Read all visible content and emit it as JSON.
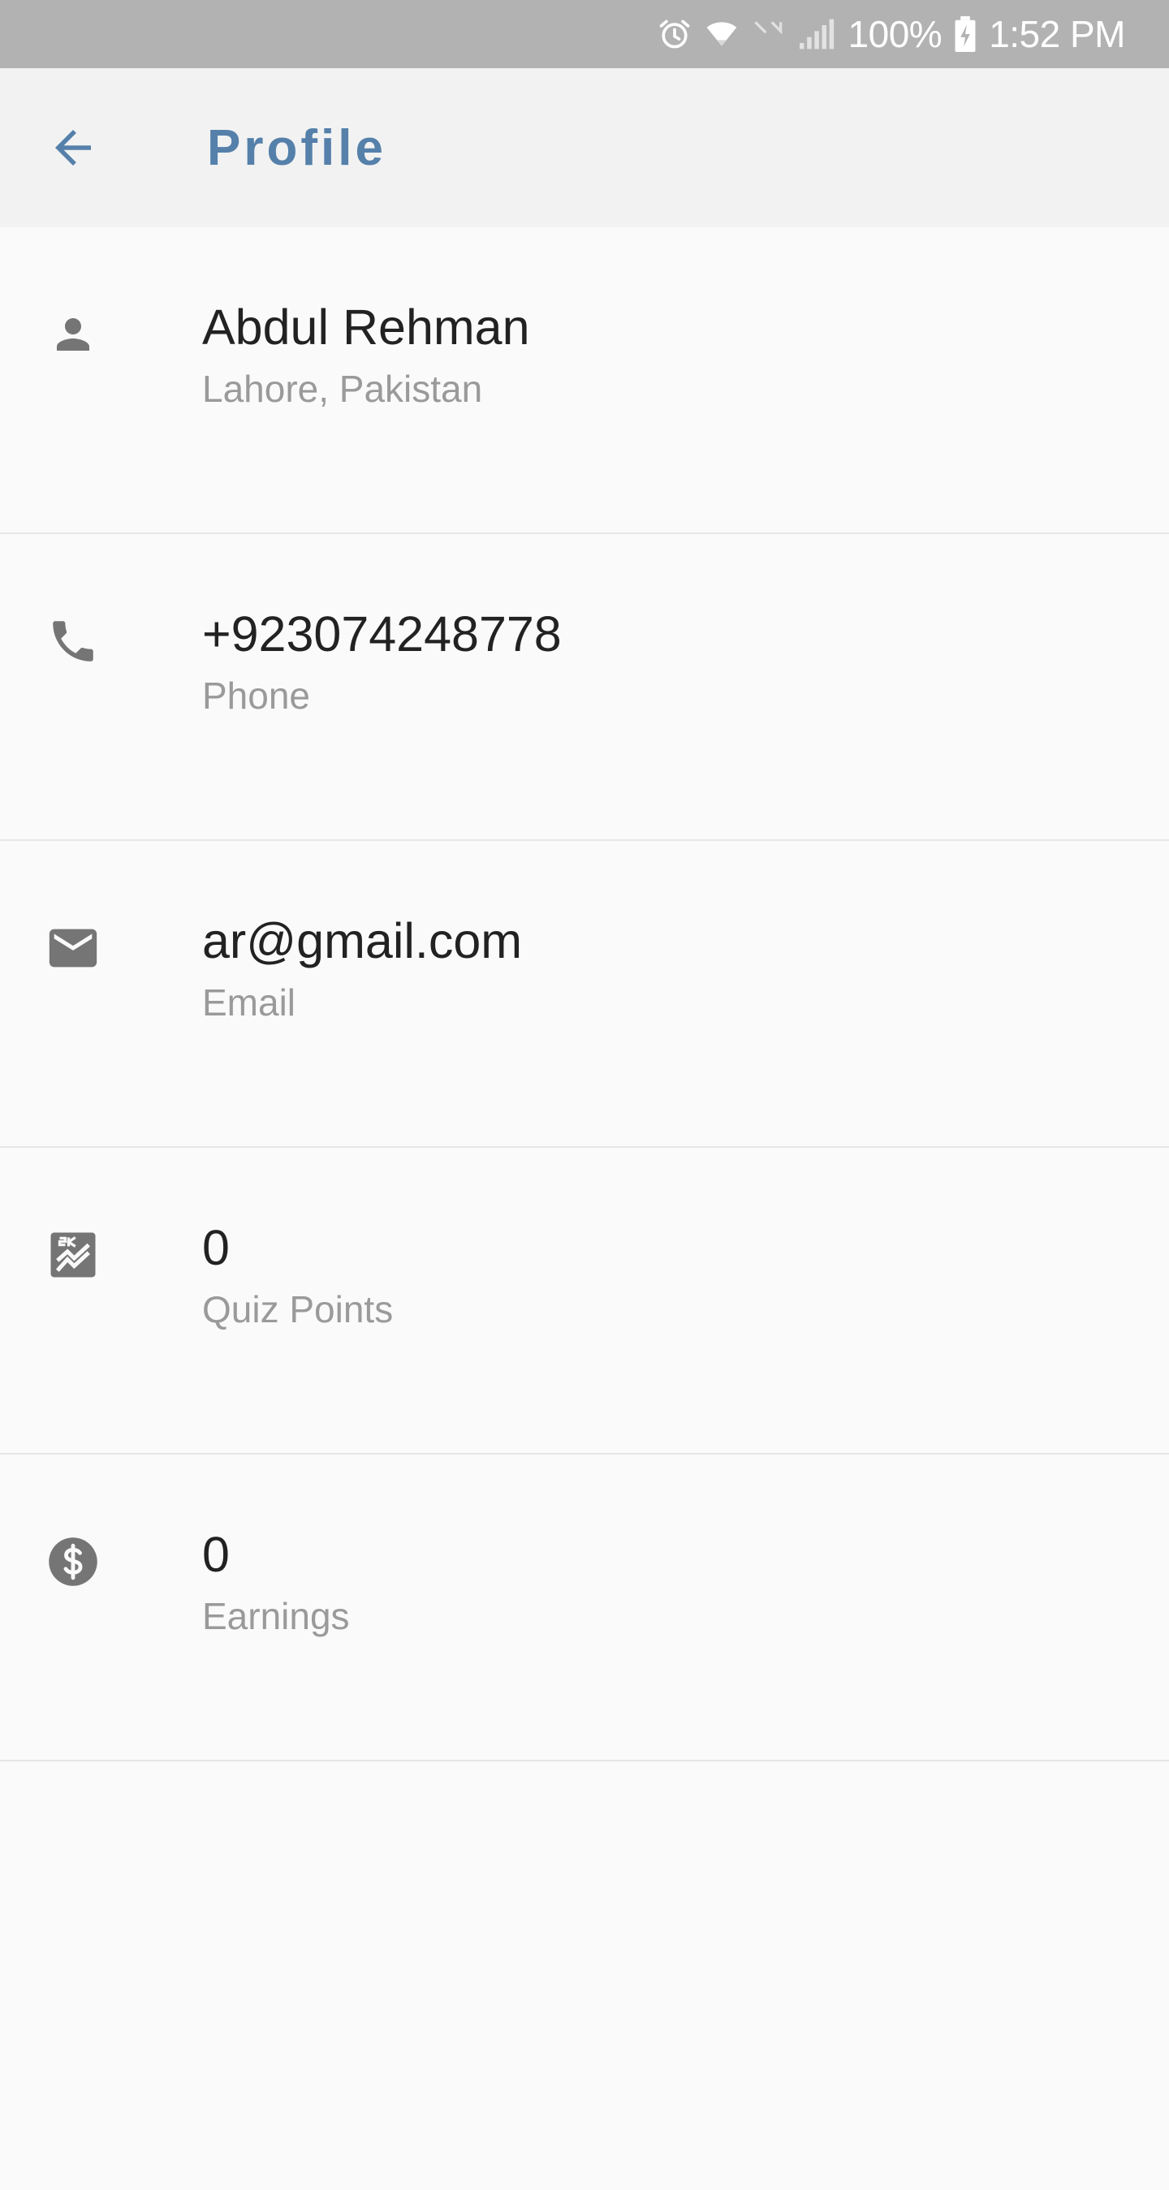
{
  "status_bar": {
    "battery": "100%",
    "time": "1:52 PM"
  },
  "header": {
    "title": "Profile",
    "back_icon": "arrow-back-icon"
  },
  "profile": {
    "items": [
      {
        "icon": "person-icon",
        "value": "Abdul Rehman",
        "label": "Lahore, Pakistan"
      },
      {
        "icon": "phone-icon",
        "value": "+923074248778",
        "label": "Phone"
      },
      {
        "icon": "email-icon",
        "value": "ar@gmail.com",
        "label": "Email"
      },
      {
        "icon": "chart-points-icon",
        "value": "0",
        "label": "Quiz Points"
      },
      {
        "icon": "dollar-icon",
        "value": "0",
        "label": "Earnings"
      }
    ]
  },
  "colors": {
    "accent": "#5580aa",
    "status_bar": "#b2b2b2",
    "app_bar": "#f2f2f2",
    "background": "#fafafa",
    "icon": "#757575"
  }
}
